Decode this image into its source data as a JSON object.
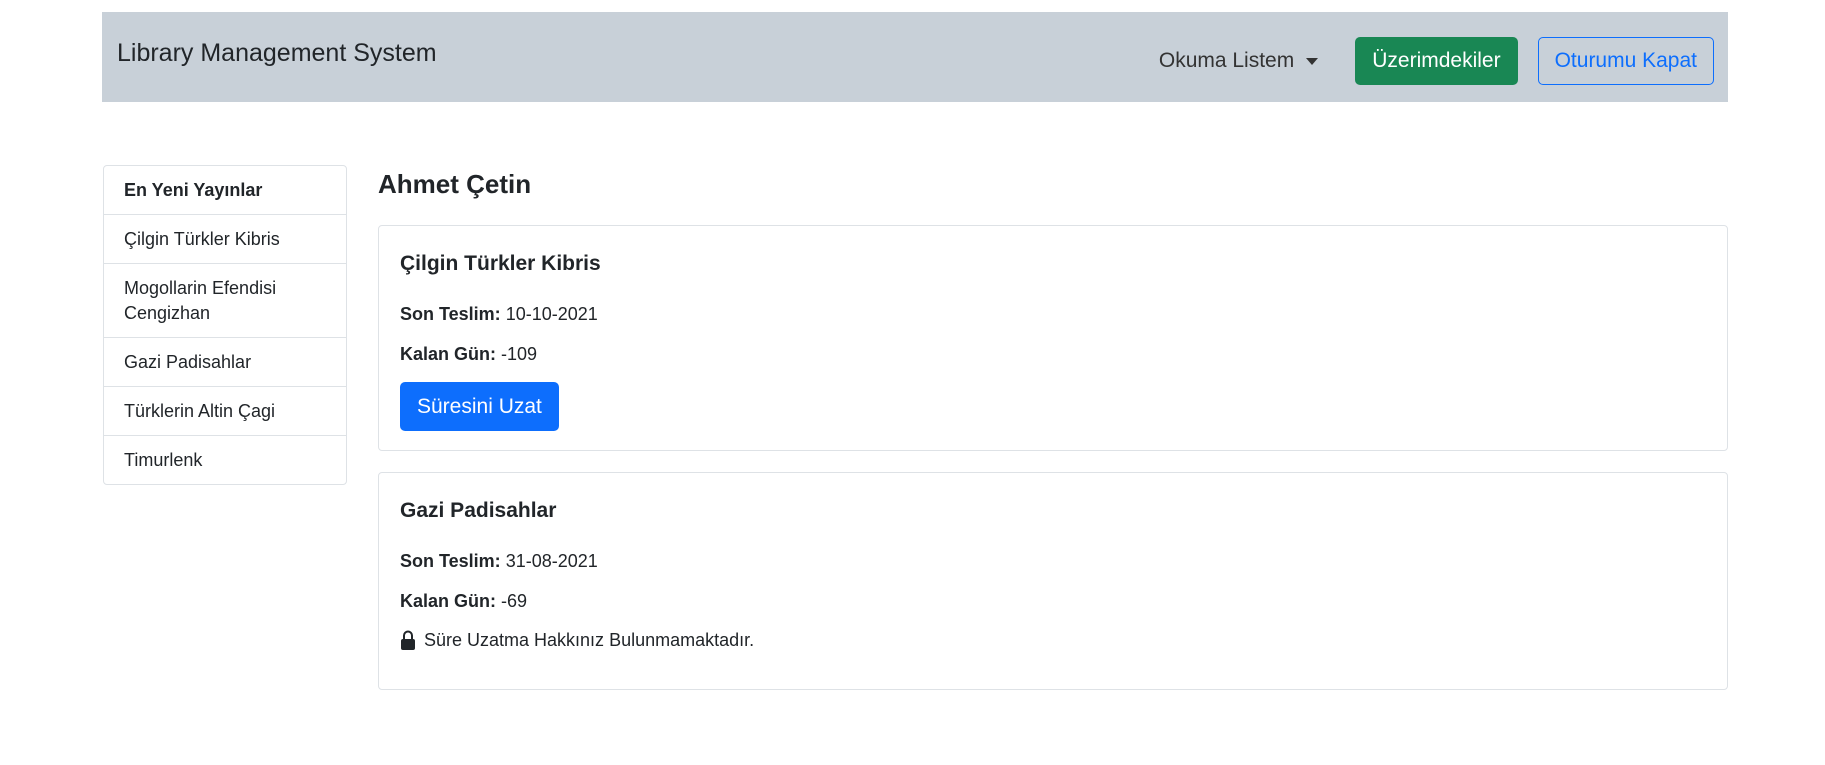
{
  "header": {
    "brand": "Library Management System",
    "reading_list_label": "Okuma Listem",
    "my_books_label": "Üzerimdekiler",
    "logout_label": "Oturumu Kapat"
  },
  "sidebar": {
    "title": "En Yeni Yayınlar",
    "items": [
      {
        "label": "Çilgin Türkler Kibris"
      },
      {
        "label": "Mogollarin Efendisi Cengizhan"
      },
      {
        "label": "Gazi Padisahlar"
      },
      {
        "label": "Türklerin Altin Çagi"
      },
      {
        "label": "Timurlenk"
      }
    ]
  },
  "main": {
    "user_name": "Ahmet Çetin",
    "due_label": "Son Teslim:",
    "remaining_label": "Kalan Gün:",
    "loans": [
      {
        "title": "Çilgin Türkler Kibris",
        "due_date": "10-10-2021",
        "remaining_days": "-109",
        "extend_label": "Süresini Uzat"
      },
      {
        "title": "Gazi Padisahlar",
        "due_date": "31-08-2021",
        "remaining_days": "-69",
        "no_extension_text": "Süre Uzatma Hakkınız Bulunmamaktadır."
      }
    ]
  },
  "colors": {
    "navbar_bg": "#c8d0d8",
    "success": "#198754",
    "primary": "#0d6efd",
    "border": "#dee2e6"
  },
  "icons": {
    "dropdown": "caret-down-icon",
    "no_extension": "lock-icon"
  }
}
